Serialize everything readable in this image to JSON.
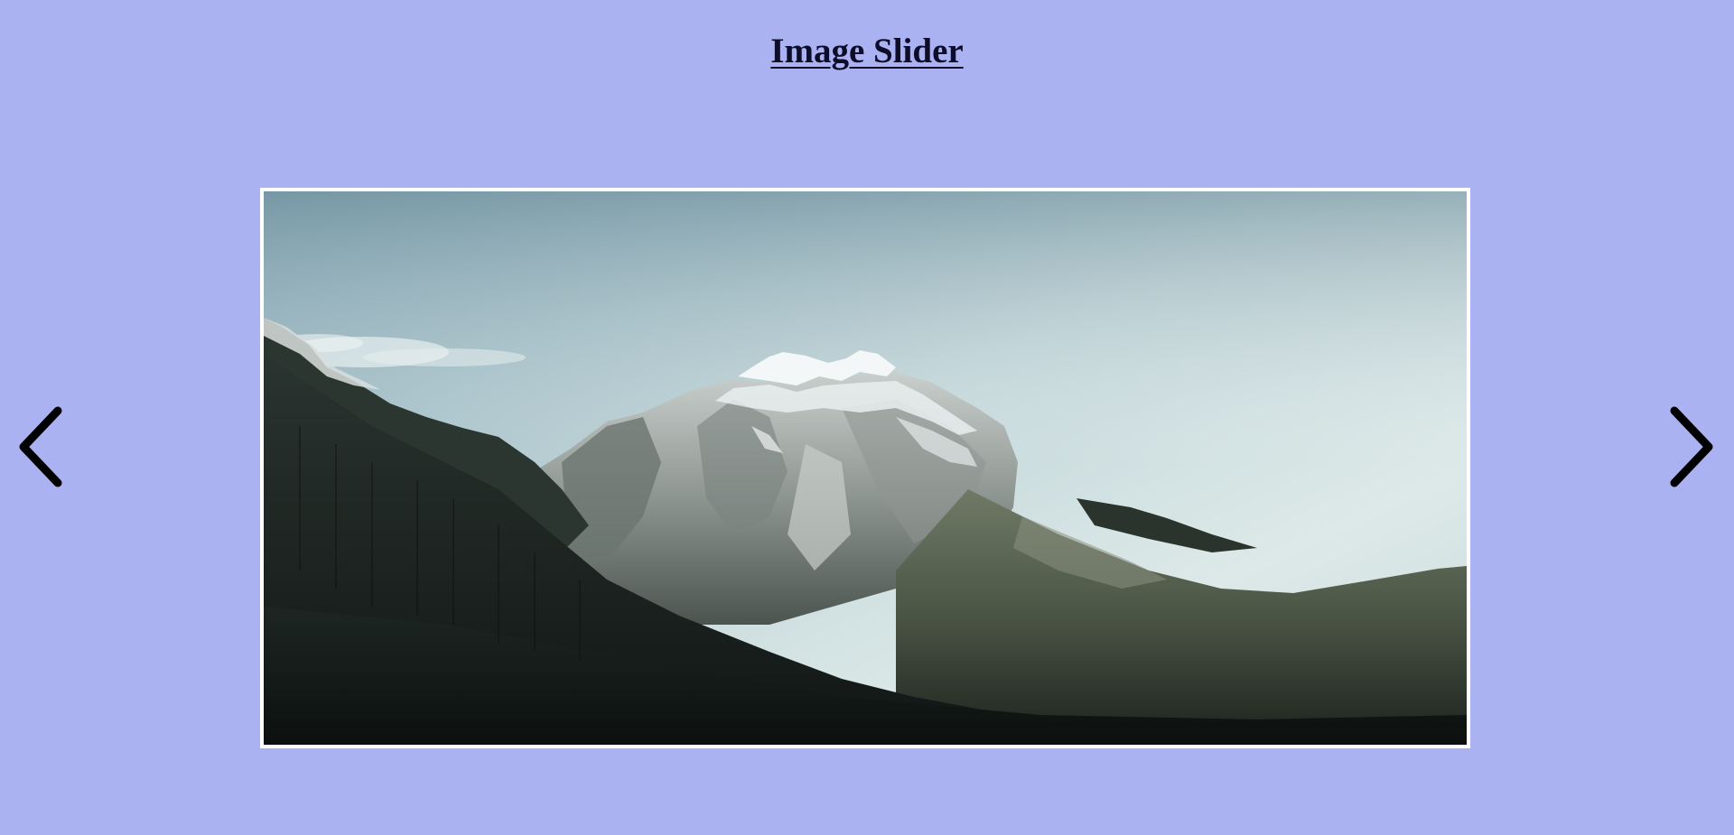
{
  "page": {
    "title": "Image Slider",
    "background_color": "#aab2f2"
  },
  "slider": {
    "current_image": {
      "icon": "mountain-landscape-image"
    },
    "prev_button": {
      "icon": "chevron-left-icon"
    },
    "next_button": {
      "icon": "chevron-right-icon"
    }
  }
}
